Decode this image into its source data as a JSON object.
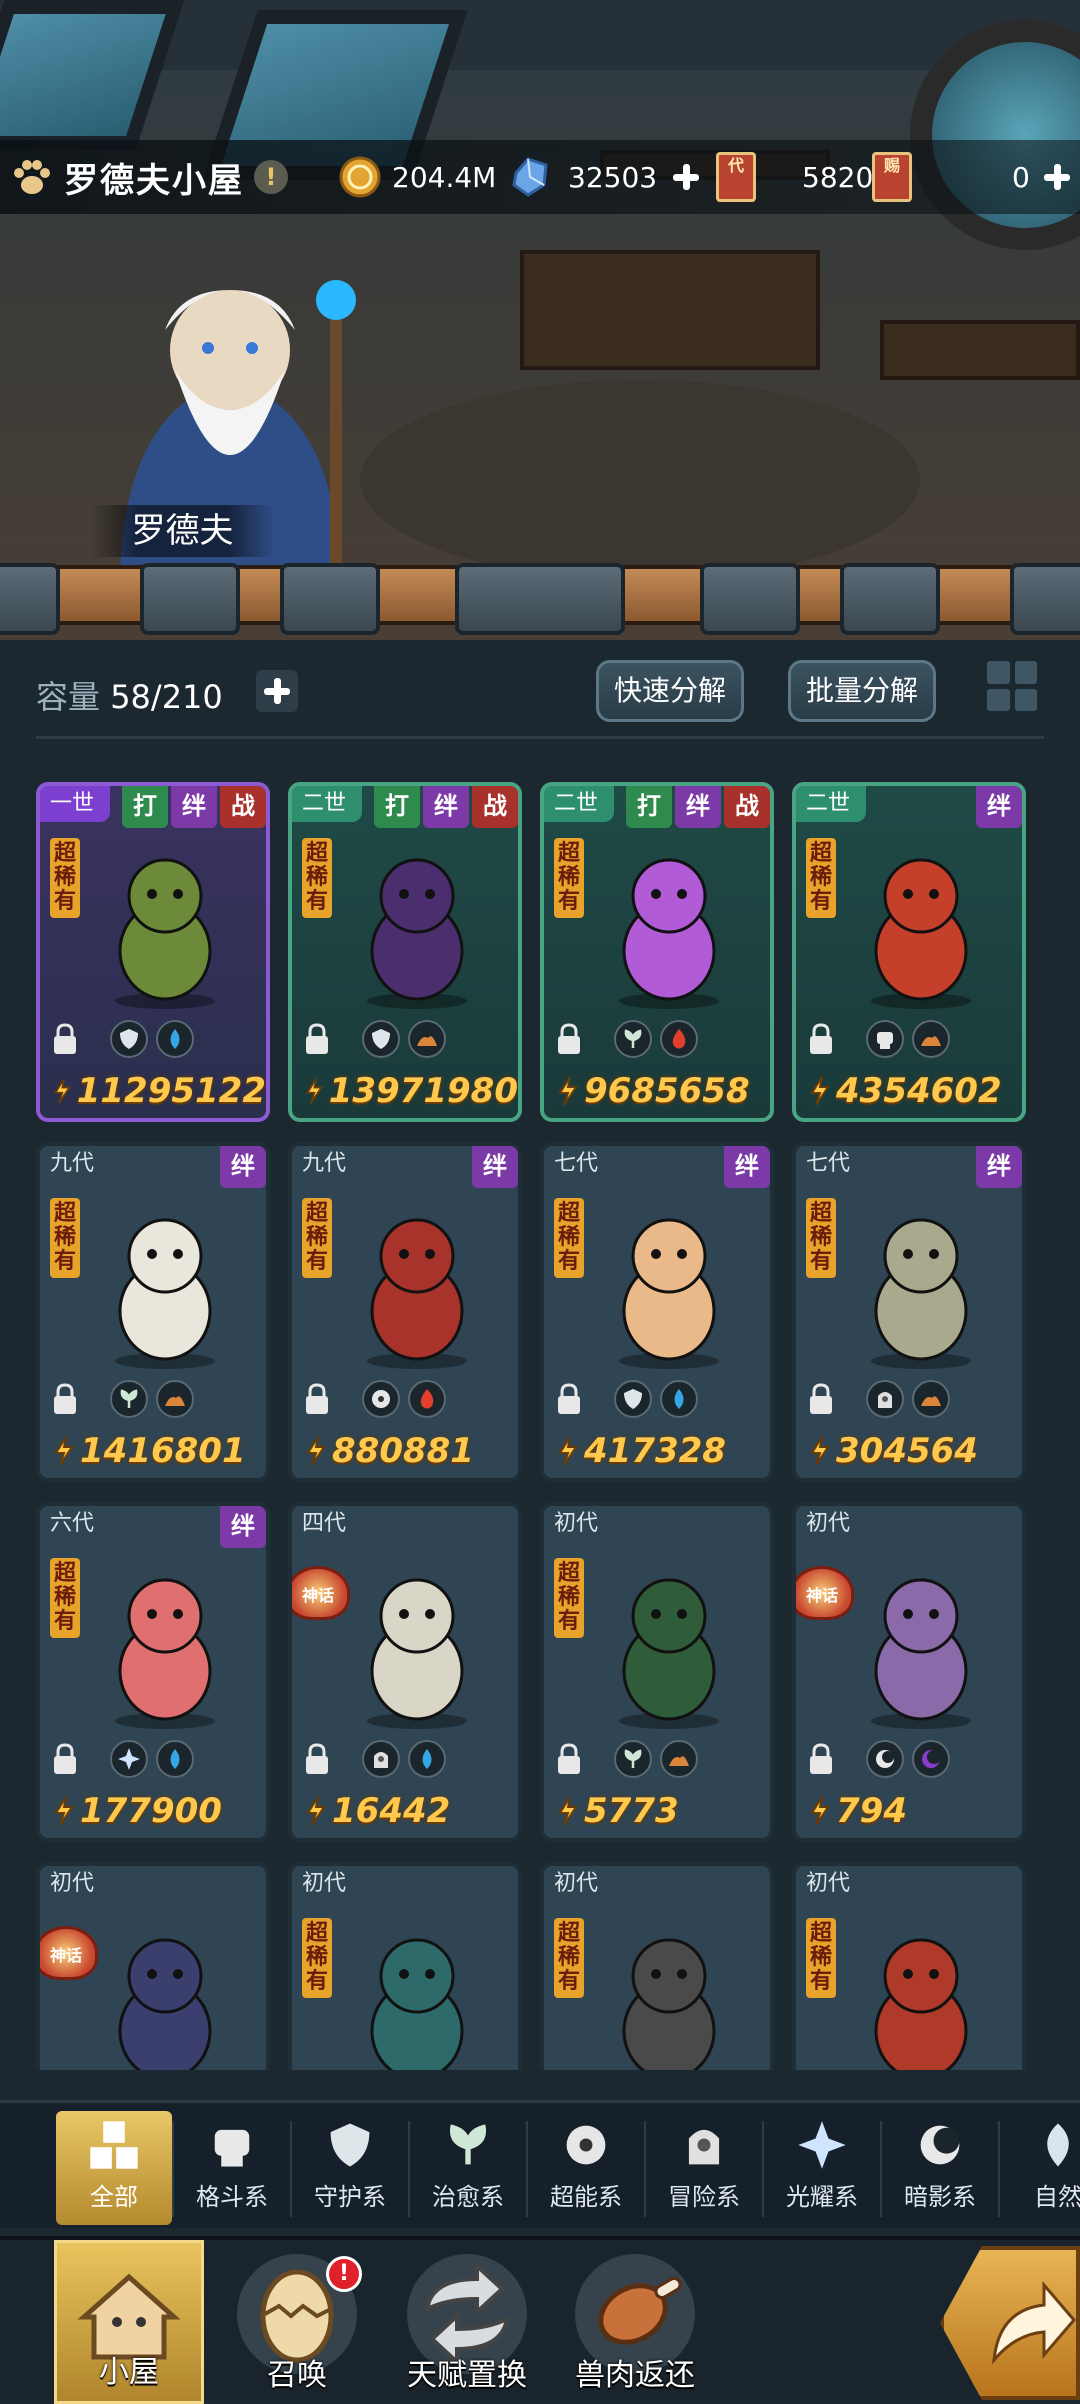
{
  "header": {
    "room_name": "罗德夫小屋",
    "warn_icon": "exclamation-icon",
    "resources": [
      {
        "name": "gold-coin-icon",
        "value": "204.4M",
        "has_plus": false
      },
      {
        "name": "crystal-icon",
        "value": "32503",
        "has_plus": true
      },
      {
        "name": "generation-ticket-icon",
        "ticket_text": "代",
        "value": "5820",
        "has_plus": false
      },
      {
        "name": "summon-ticket-icon",
        "ticket_text": "赐",
        "value": "0",
        "has_plus": true
      }
    ]
  },
  "npc": {
    "name": "罗德夫"
  },
  "inventory": {
    "capacity_label": "容量",
    "capacity_value": "58/210",
    "quick_decompose": "快速分解",
    "batch_decompose": "批量分解"
  },
  "cards": [
    {
      "gen": "一世",
      "frame": "purple",
      "tags": [
        "打",
        "绊",
        "战"
      ],
      "rarity": "超稀有",
      "seal": "",
      "types": [
        "shield-icon",
        "water-drop-icon"
      ],
      "power": "11295122",
      "creature_color": "#6c8a3a"
    },
    {
      "gen": "二世",
      "frame": "green",
      "tags": [
        "打",
        "绊",
        "战"
      ],
      "rarity": "超稀有",
      "seal": "",
      "types": [
        "shield-icon",
        "earth-icon"
      ],
      "power": "13971980",
      "creature_color": "#4a2e6e"
    },
    {
      "gen": "二世",
      "frame": "green",
      "tags": [
        "打",
        "绊",
        "战"
      ],
      "rarity": "超稀有",
      "seal": "",
      "types": [
        "leaf-icon",
        "fire-icon"
      ],
      "power": "9685658",
      "creature_color": "#b15bd6"
    },
    {
      "gen": "二世",
      "frame": "green",
      "tags": [
        "绊"
      ],
      "rarity": "超稀有",
      "seal": "",
      "types": [
        "fist-icon",
        "earth-icon"
      ],
      "power": "4354602",
      "creature_color": "#c4402a"
    },
    {
      "gen": "九代",
      "frame": "normal",
      "tags": [
        "绊"
      ],
      "rarity": "超稀有",
      "seal": "",
      "types": [
        "leaf-icon",
        "earth-icon"
      ],
      "power": "1416801",
      "creature_color": "#e9e6dc"
    },
    {
      "gen": "九代",
      "frame": "normal",
      "tags": [
        "绊"
      ],
      "rarity": "超稀有",
      "seal": "",
      "types": [
        "psychic-icon",
        "fire-icon"
      ],
      "power": "880881",
      "creature_color": "#a8332a"
    },
    {
      "gen": "七代",
      "frame": "normal",
      "tags": [
        "绊"
      ],
      "rarity": "超稀有",
      "seal": "",
      "types": [
        "shield-icon",
        "water-drop-icon"
      ],
      "power": "417328",
      "creature_color": "#e9b98a"
    },
    {
      "gen": "七代",
      "frame": "normal",
      "tags": [
        "绊"
      ],
      "rarity": "超稀有",
      "seal": "",
      "types": [
        "adventure-icon",
        "earth-icon"
      ],
      "power": "304564",
      "creature_color": "#a9a98e"
    },
    {
      "gen": "六代",
      "frame": "normal",
      "tags": [
        "绊"
      ],
      "rarity": "超稀有",
      "seal": "",
      "types": [
        "light-icon",
        "water-drop-icon"
      ],
      "power": "177900",
      "creature_color": "#e07070"
    },
    {
      "gen": "四代",
      "frame": "normal",
      "tags": [],
      "rarity": "",
      "seal": "神话",
      "types": [
        "adventure-icon",
        "water-drop-icon"
      ],
      "power": "16442",
      "creature_color": "#d9d6c8"
    },
    {
      "gen": "初代",
      "frame": "normal",
      "tags": [],
      "rarity": "超稀有",
      "seal": "",
      "types": [
        "leaf-icon",
        "earth-icon"
      ],
      "power": "5773",
      "creature_color": "#2f5d3a"
    },
    {
      "gen": "初代",
      "frame": "normal",
      "tags": [],
      "rarity": "",
      "seal": "神话",
      "types": [
        "shadow-icon",
        "moon-icon"
      ],
      "power": "794",
      "creature_color": "#8a6aa8"
    },
    {
      "gen": "初代",
      "frame": "normal",
      "tags": [],
      "rarity": "",
      "seal": "神话",
      "types": [],
      "power": "",
      "creature_color": "#3a3f6e"
    },
    {
      "gen": "初代",
      "frame": "normal",
      "tags": [],
      "rarity": "超稀有",
      "seal": "",
      "types": [],
      "power": "",
      "creature_color": "#2f6a6a"
    },
    {
      "gen": "初代",
      "frame": "normal",
      "tags": [],
      "rarity": "超稀有",
      "seal": "",
      "types": [],
      "power": "",
      "creature_color": "#4a4a4a"
    },
    {
      "gen": "初代",
      "frame": "normal",
      "tags": [],
      "rarity": "超稀有",
      "seal": "",
      "types": [],
      "power": "",
      "creature_color": "#b03a2a"
    }
  ],
  "categories": [
    {
      "label": "全部",
      "icon": "blocks-icon",
      "active": true
    },
    {
      "label": "格斗系",
      "icon": "fist-icon",
      "active": false
    },
    {
      "label": "守护系",
      "icon": "shield-icon",
      "active": false
    },
    {
      "label": "治愈系",
      "icon": "leaf-icon",
      "active": false
    },
    {
      "label": "超能系",
      "icon": "psychic-icon",
      "active": false
    },
    {
      "label": "冒险系",
      "icon": "adventure-icon",
      "active": false
    },
    {
      "label": "光耀系",
      "icon": "light-icon",
      "active": false
    },
    {
      "label": "暗影系",
      "icon": "shadow-icon",
      "active": false
    },
    {
      "label": "自然",
      "icon": "nature-icon",
      "active": false
    }
  ],
  "bottom_nav": [
    {
      "label": "小屋",
      "icon": "house-icon",
      "active": true,
      "alert": false
    },
    {
      "label": "召唤",
      "icon": "egg-icon",
      "active": false,
      "alert": true
    },
    {
      "label": "天赋置换",
      "icon": "swap-icon",
      "active": false,
      "alert": false
    },
    {
      "label": "兽肉返还",
      "icon": "meat-icon",
      "active": false,
      "alert": false
    }
  ],
  "alert_mark": "!",
  "colors": {
    "gold": "#ffc94d",
    "accent_active": "#e8c766",
    "background": "#1c2830"
  }
}
